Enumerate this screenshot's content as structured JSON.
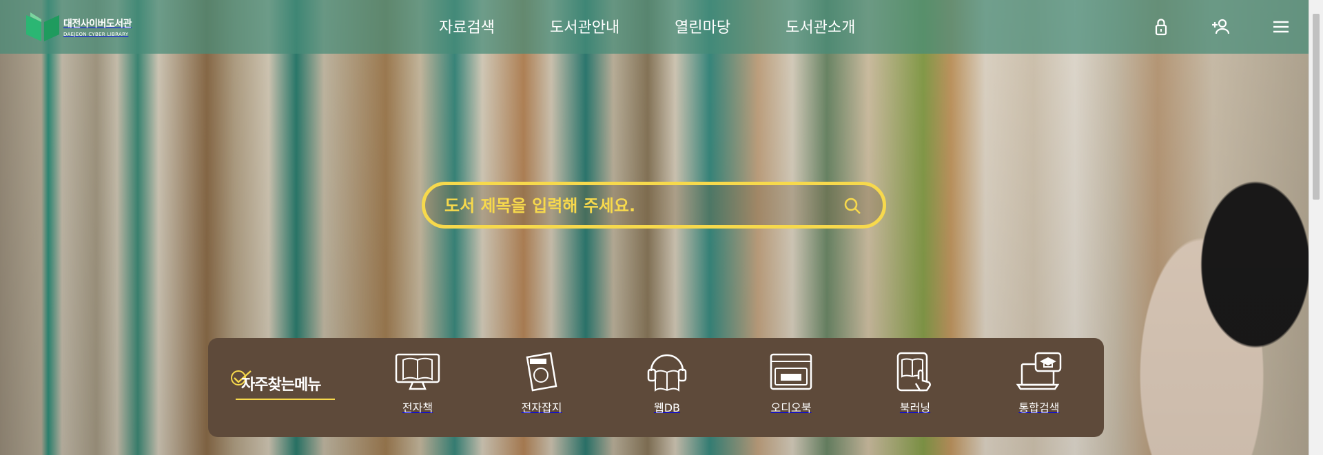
{
  "header": {
    "logo": {
      "korean": "대전사이버도서관",
      "english": "DAEJEON CYBER LIBRARY",
      "icon": "book-logo-icon"
    },
    "nav": [
      "자료검색",
      "도서관안내",
      "열린마당",
      "도서관소개"
    ],
    "icons": [
      "lock-icon",
      "add-user-icon",
      "hamburger-menu-icon"
    ]
  },
  "search": {
    "placeholder": "도서 제목을 입력해 주세요.",
    "icon": "search-icon"
  },
  "quick_menu": {
    "title": "자주찾는메뉴",
    "items": [
      {
        "label": "전자책",
        "icon": "ebook-monitor-icon"
      },
      {
        "label": "전자잡지",
        "icon": "magazine-icon"
      },
      {
        "label": "웹DB",
        "icon": "headphones-book-icon"
      },
      {
        "label": "오디오북",
        "icon": "audio-device-icon"
      },
      {
        "label": "북러닝",
        "icon": "tablet-touch-icon"
      },
      {
        "label": "통합검색",
        "icon": "laptop-graduation-icon"
      }
    ]
  },
  "colors": {
    "accent_yellow": "#f7d94c",
    "header_green": "#468c78",
    "quick_brown": "#5e4a3a"
  }
}
